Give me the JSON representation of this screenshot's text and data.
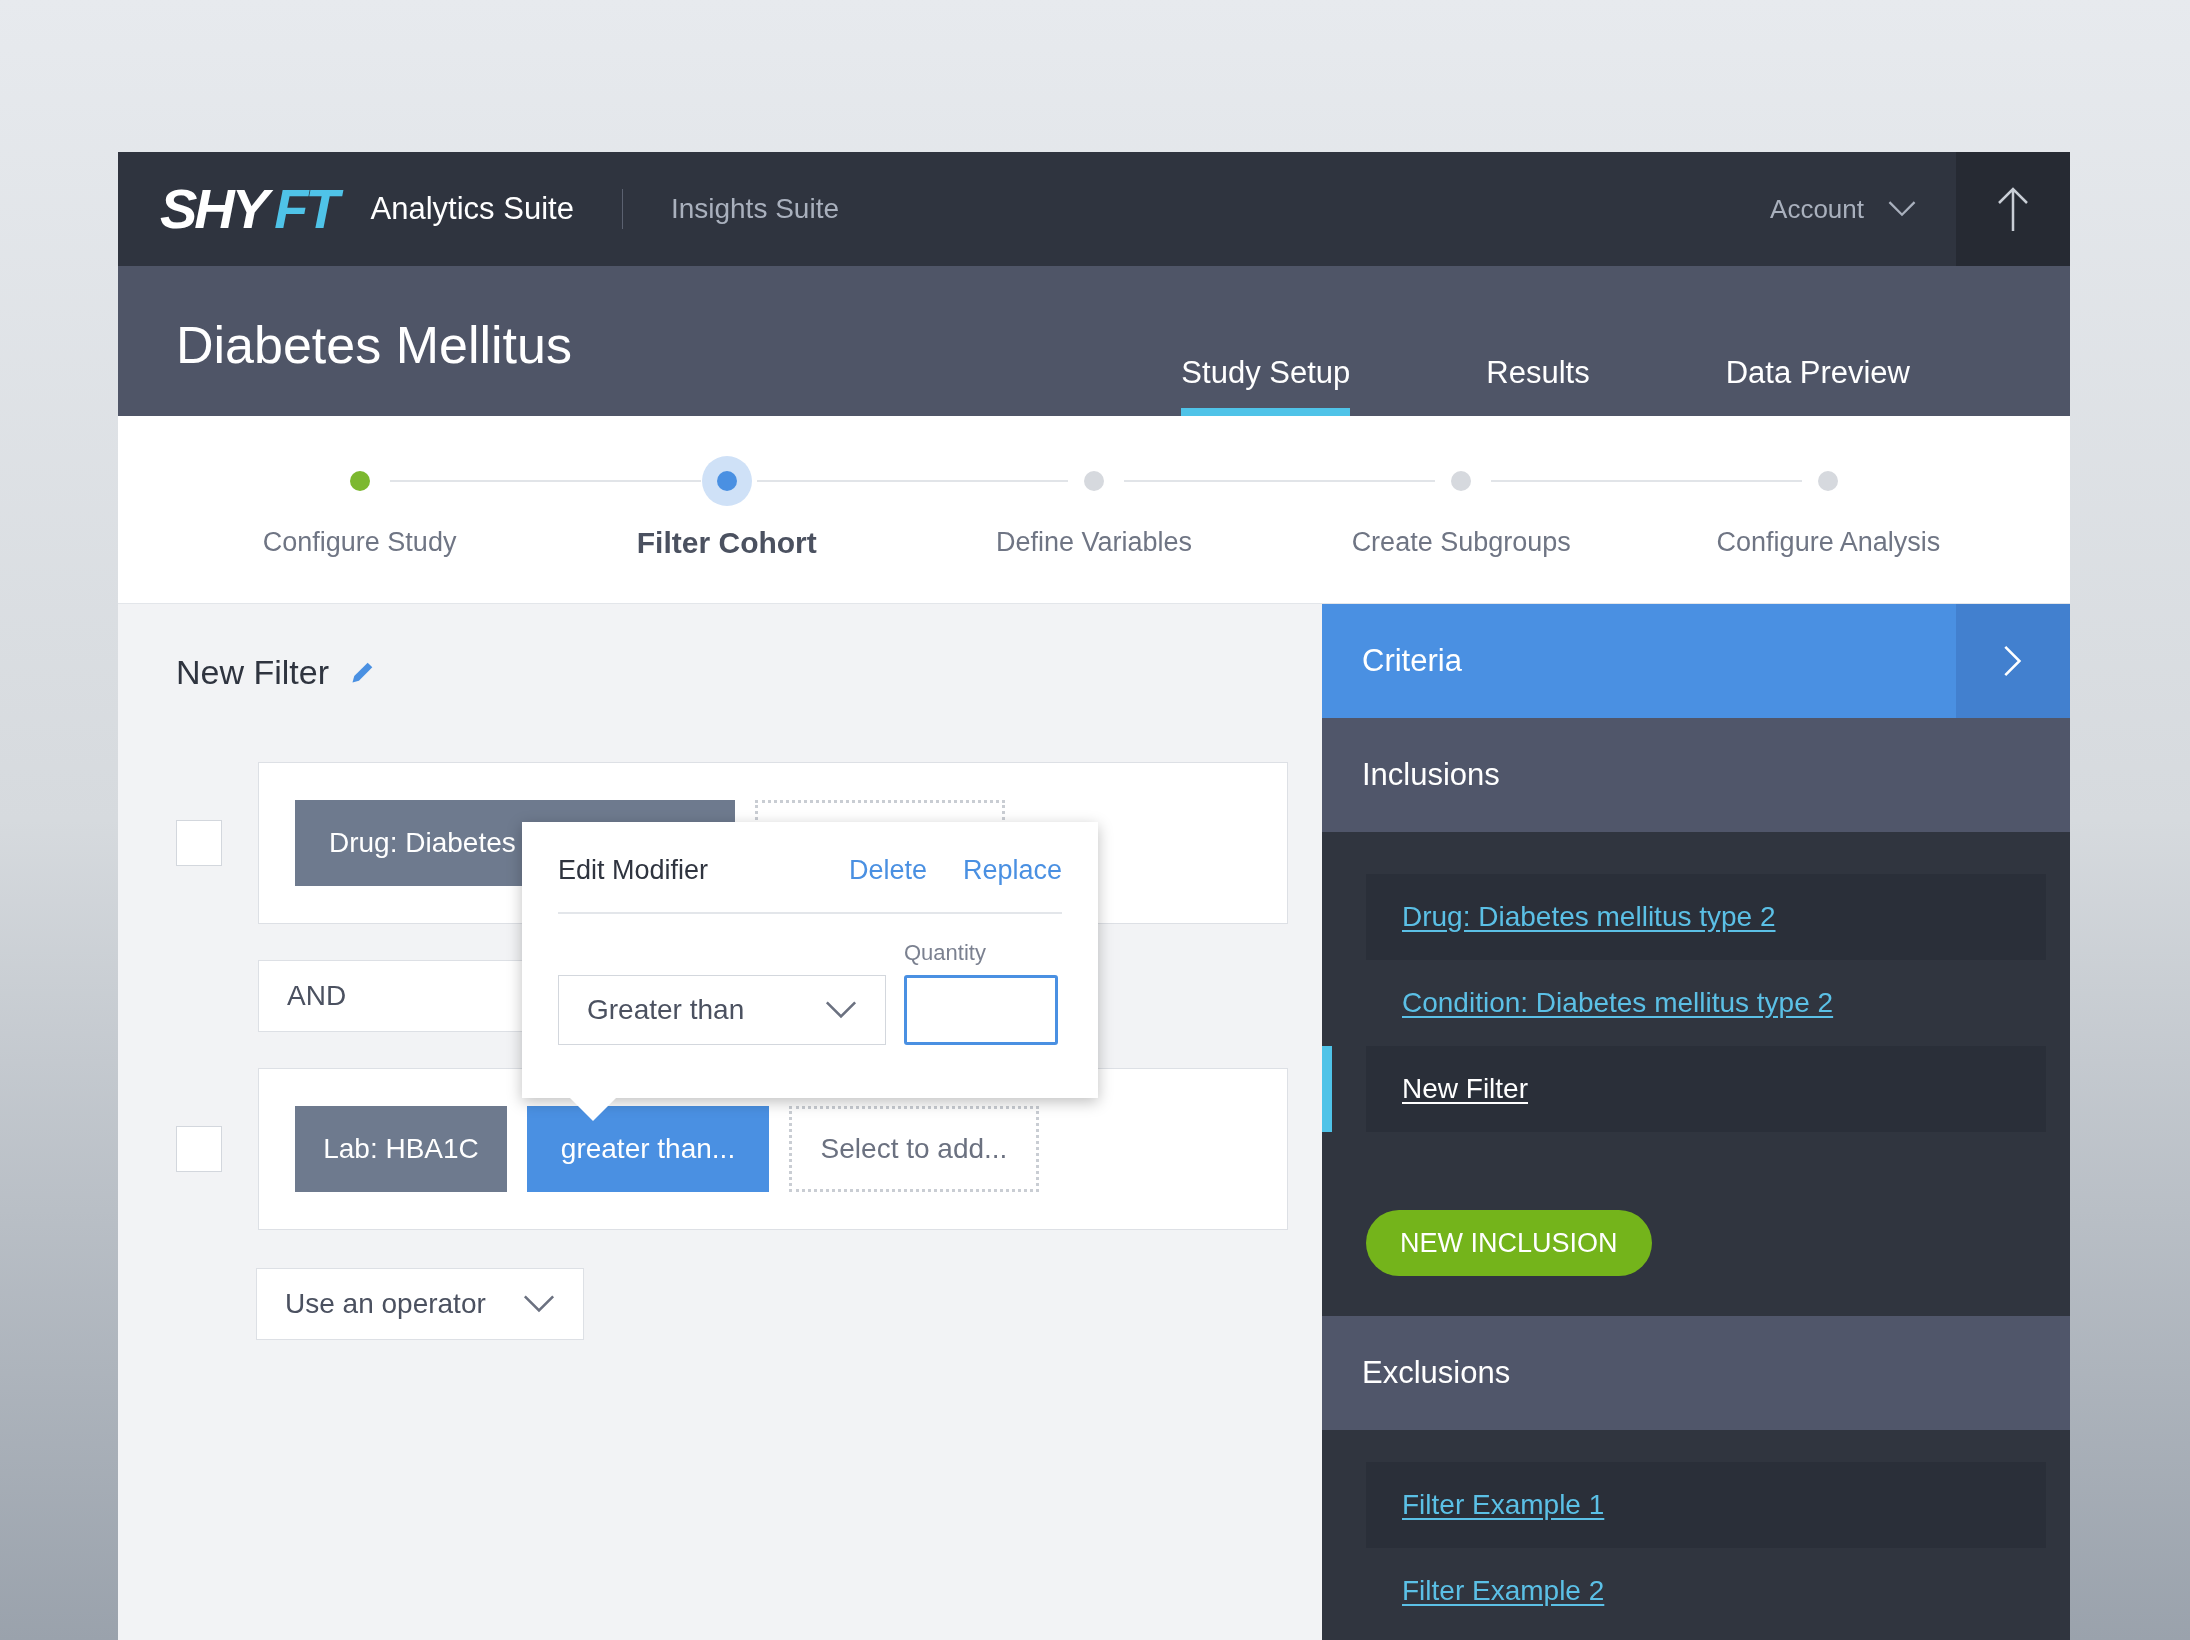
{
  "topbar": {
    "logo": [
      {
        "text": "SHY",
        "color": "#ffffff"
      },
      {
        "text": "FT",
        "color": "#4fc3e8"
      }
    ],
    "app": "Analytics Suite",
    "link": "Insights Suite",
    "account": "Account"
  },
  "study": {
    "title": "Diabetes Mellitus",
    "tabs": [
      {
        "label": "Study Setup",
        "selected": true
      },
      {
        "label": "Results",
        "selected": false
      },
      {
        "label": "Data Preview",
        "selected": false
      }
    ]
  },
  "steps": [
    {
      "label": "Configure Study",
      "done": true,
      "selected": false
    },
    {
      "label": "Filter Cohort",
      "done": false,
      "selected": true
    },
    {
      "label": "Define Variables",
      "done": false,
      "selected": false
    },
    {
      "label": "Create Subgroups",
      "done": false,
      "selected": false
    },
    {
      "label": "Configure Analysis",
      "done": false,
      "selected": false
    }
  ],
  "filter": {
    "title": "New Filter",
    "rows": [
      {
        "checked": false,
        "chips": [
          {
            "kind": "criterion",
            "text": "Drug: Diabetes"
          },
          {
            "kind": "empty"
          }
        ]
      },
      {
        "checked": false,
        "chips": [
          {
            "kind": "criterion",
            "text": "Lab: HBA1C"
          },
          {
            "kind": "modifier",
            "text": "greater than..."
          },
          {
            "kind": "empty",
            "text": "Select to add..."
          }
        ]
      }
    ],
    "operator": "AND",
    "operator_placeholder": "Use an operator"
  },
  "popover": {
    "title": "Edit Modifier",
    "actions": [
      "Delete",
      "Replace"
    ],
    "select": "Greater than",
    "quantity_label": "Quantity"
  },
  "panel": {
    "title": "Criteria",
    "inclusions": {
      "title": "Inclusions",
      "items": [
        {
          "label": "Drug: Diabetes mellitus type 2",
          "selected": false
        },
        {
          "label": "Condition: Diabetes mellitus type 2",
          "selected": false
        },
        {
          "label": "New Filter",
          "selected": true
        }
      ],
      "button": "NEW INCLUSION"
    },
    "exclusions": {
      "title": "Exclusions",
      "items": [
        {
          "label": "Filter Example 1",
          "selected": false
        },
        {
          "label": "Filter Example 2",
          "selected": false
        }
      ]
    }
  }
}
